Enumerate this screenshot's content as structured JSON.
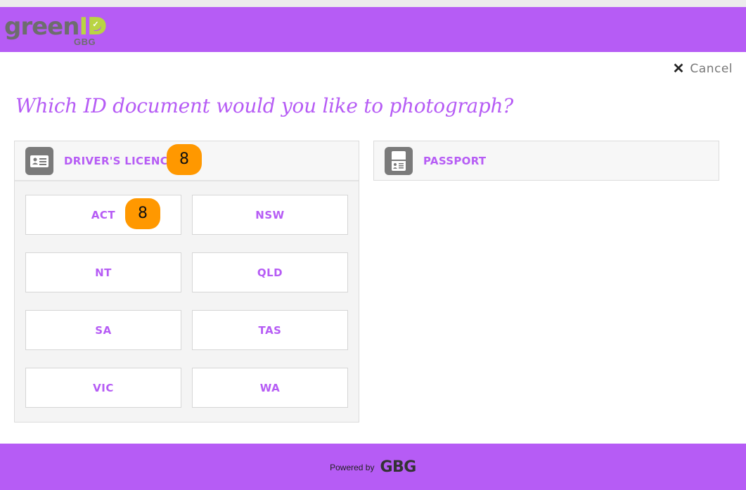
{
  "header": {
    "logo_text": "green",
    "logo_text_id": "ID",
    "logo_sub": "GBG",
    "check_icon": "check-circle-icon",
    "brand_color": "#b65cf5",
    "accent_color": "#b9d443"
  },
  "cancel": {
    "icon": "close-icon",
    "label": "Cancel"
  },
  "title": "Which ID document would you like to photograph?",
  "documents": {
    "drivers_licence": {
      "label": "DRIVER'S LICENCE",
      "icon": "id-card-icon",
      "badge": "8"
    },
    "passport": {
      "label": "PASSPORT",
      "icon": "passport-icon"
    }
  },
  "states": [
    {
      "label": "ACT",
      "badge": "8"
    },
    {
      "label": "NSW"
    },
    {
      "label": "NT"
    },
    {
      "label": "QLD"
    },
    {
      "label": "SA"
    },
    {
      "label": "TAS"
    },
    {
      "label": "VIC"
    },
    {
      "label": "WA"
    }
  ],
  "badge_color": "#ff9800",
  "footer": {
    "powered_by": "Powered by",
    "brand": "GBG"
  }
}
